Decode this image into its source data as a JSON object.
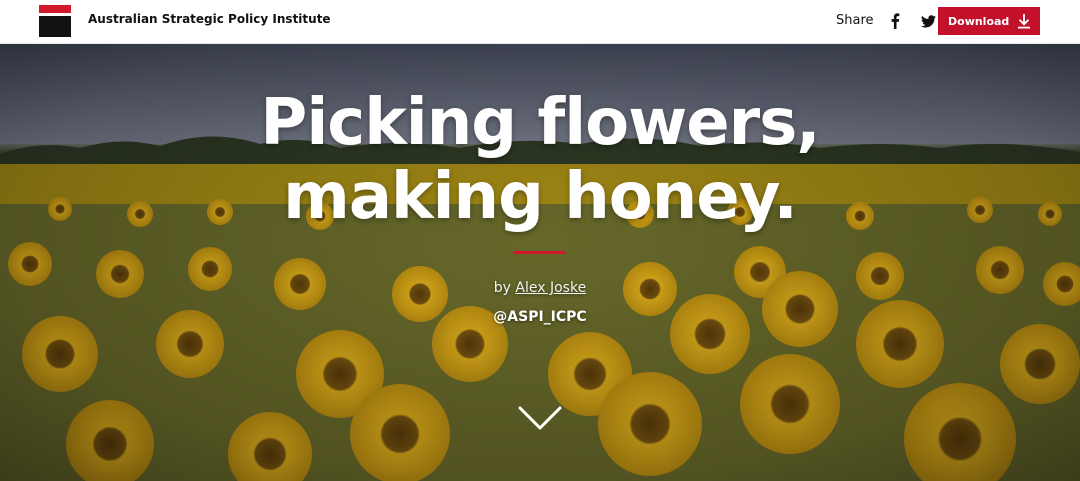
{
  "header": {
    "org_name": "Australian Strategic Policy Institute",
    "share_label": "Share",
    "download_label": "Download",
    "icons": {
      "logo": "aspi-logo",
      "facebook": "facebook-icon",
      "twitter": "twitter-icon",
      "download": "download-arrow-icon"
    },
    "colors": {
      "brand_red": "#c3112c",
      "logo_black": "#111111"
    }
  },
  "hero": {
    "title_line_1": "Picking flowers,",
    "title_line_2": "making honey.",
    "byline_prefix": "by ",
    "author": "Alex Joske",
    "handle": "@ASPI_ICPC",
    "accent_color": "#d2182d",
    "background": "sunflower-field-photo",
    "scroll_icon": "chevron-down-icon"
  }
}
